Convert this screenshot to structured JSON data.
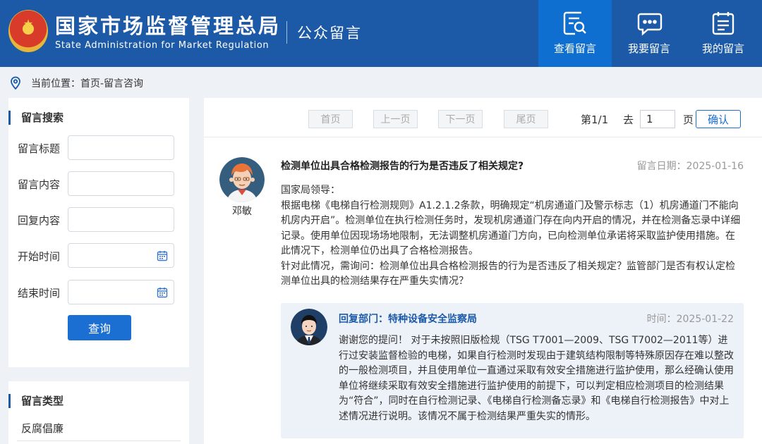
{
  "header": {
    "logo_cn": "国家市场监督管理总局",
    "logo_en": "State Administration for Market Regulation",
    "section_title": "公众留言",
    "nav": [
      {
        "label": "查看留言",
        "icon": "search-message-icon",
        "active": true
      },
      {
        "label": "我要留言",
        "icon": "chat-bubble-icon",
        "active": false
      },
      {
        "label": "我的留言",
        "icon": "clipboard-list-icon",
        "active": false
      }
    ]
  },
  "breadcrumb": {
    "icon": "location-pin-icon",
    "text": "当前位置：首页-留言咨询"
  },
  "search": {
    "title": "留言搜索",
    "fields": [
      {
        "label": "留言标题",
        "value": ""
      },
      {
        "label": "留言内容",
        "value": ""
      },
      {
        "label": "回复内容",
        "value": ""
      },
      {
        "label": "开始时间",
        "value": "",
        "icon": "calendar-icon"
      },
      {
        "label": "结束时间",
        "value": "",
        "icon": "calendar-icon"
      }
    ],
    "button": "查询"
  },
  "types": {
    "title": "留言类型",
    "items": [
      "反腐倡廉"
    ]
  },
  "pager": {
    "first": "首页",
    "prev": "上一页",
    "next": "下一页",
    "last": "尾页",
    "status": "第1/1",
    "goto": "去",
    "page_value": "1",
    "page_unit": "页",
    "confirm": "确认"
  },
  "message": {
    "author": "邓敏",
    "title": "检测单位出具合格检测报告的行为是否违反了相关规定?",
    "date": "留言日期：2025-01-16",
    "body": [
      "国家局领导：",
      "根据电梯《电梯自行检测规则》A1.2.1.2条款，明确规定“机房通道门及警示标志（1）机房通道门不能向机房内开启”。检测单位在执行检测任务时，发现机房通道门存在向内开启的情况，并在检测备忘录中详细记录。使用单位因现场场地限制，无法调整机房通道门方向，已向检测单位承诺将采取监护使用措施。在此情况下，检测单位仍出具了合格检测报告。",
      "针对此情况，需询问：检测单位出具合格检测报告的行为是否违反了相关规定？监管部门是否有权认定检测单位出具的检测结果存在严重失实情况？"
    ]
  },
  "reply": {
    "dept": "回复部门：特种设备安全监察局",
    "date": "时间：2025-01-22",
    "body": "谢谢您的提问！ 对于未按照旧版检规（TSG T7001—2009、TSG T7002—2011等）进行过安装监督检验的电梯，如果自行检测时发现由于建筑结构限制等特殊原因存在难以整改的一般检测项目，并且使用单位一直通过采取有效安全措施进行监护使用，那么经确认使用单位将继续采取有效安全措施进行监护使用的前提下，可以判定相应检测项目的检测结果为“符合”，同时在自行检测记录、《电梯自行检测备忘录》和《电梯自行检测报告》中对上述情况进行说明。该情况不属于检测结果严重失实的情形。"
  },
  "colors": {
    "header_bg": "#1c5aa8",
    "nav_active": "#0f6fd1",
    "accent": "#1c6fd2",
    "reply_bg": "#edf2f9"
  }
}
